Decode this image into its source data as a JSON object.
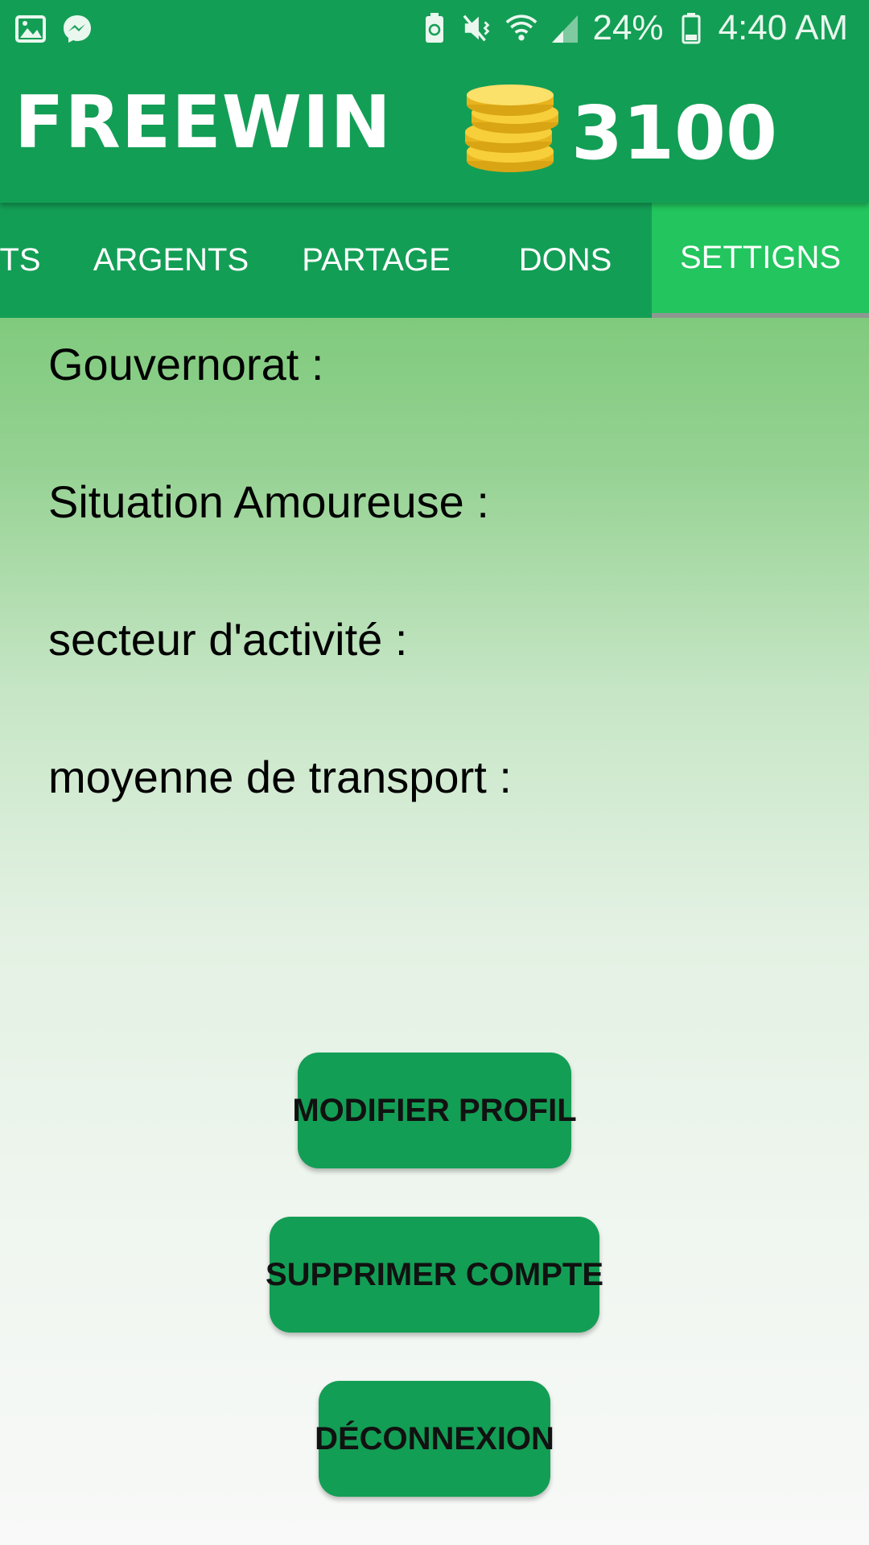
{
  "status_bar": {
    "battery_percent": "24%",
    "time": "4:40 AM",
    "icons": [
      "image-icon",
      "messenger-icon",
      "battery-saver-icon",
      "mute-vibrate-icon",
      "wifi-icon",
      "signal-icon",
      "battery-icon"
    ]
  },
  "header": {
    "title": "FREEWIN",
    "coins": "3100",
    "coins_icon": "coin-stack-icon"
  },
  "tabs": [
    {
      "label": "TS"
    },
    {
      "label": "ARGENTS"
    },
    {
      "label": "PARTAGE"
    },
    {
      "label": "DONS"
    },
    {
      "label": "SETTIGNS",
      "active": true
    }
  ],
  "fields": {
    "gouvernorat": "Gouvernorat :",
    "situation": "Situation Amoureuse :",
    "secteur": "secteur d'activité :",
    "transport": "moyenne de transport :"
  },
  "buttons": {
    "modifier": "MODIFIER PROFIL",
    "supprimer": "SUPPRIMER COMPTE",
    "deconnexion": "DÉCONNEXION"
  },
  "colors": {
    "primary": "#139e55",
    "active_tab": "#22c55e"
  }
}
